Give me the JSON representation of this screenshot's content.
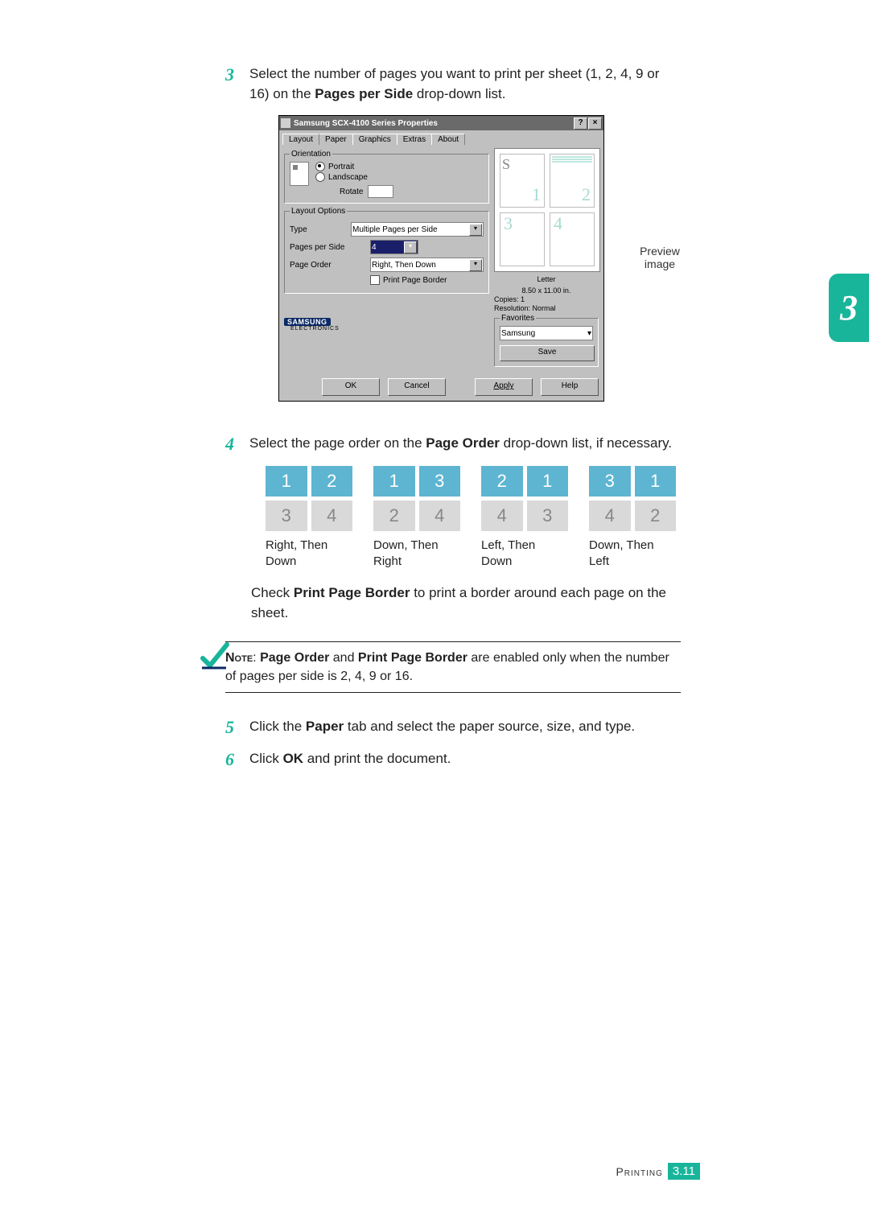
{
  "sideTab": "3",
  "steps": {
    "s3": {
      "num": "3",
      "text_a": "Select the number of pages you want to print per sheet (1, 2, 4, 9 or 16) on the ",
      "bold": "Pages per Side",
      "text_b": " drop-down list."
    },
    "s4": {
      "num": "4",
      "text_a": "Select the page order on the ",
      "bold": "Page Order",
      "text_b": " drop-down list, if necessary."
    },
    "s5": {
      "num": "5",
      "text_a": "Click the ",
      "bold": "Paper",
      "text_b": " tab and select the paper source, size, and type."
    },
    "s6": {
      "num": "6",
      "text_a": "Click ",
      "bold": "OK",
      "text_b": " and print the document."
    }
  },
  "dialog": {
    "title": "Samsung SCX-4100 Series Properties",
    "help_btn": "?",
    "close_btn": "×",
    "tabs": [
      "Layout",
      "Paper",
      "Graphics",
      "Extras",
      "About"
    ],
    "orientation": {
      "legend": "Orientation",
      "portrait": "Portrait",
      "landscape": "Landscape",
      "rotate": "Rotate"
    },
    "callout": "Preview image",
    "layout": {
      "legend": "Layout Options",
      "type_label": "Type",
      "type_value": "Multiple Pages per Side",
      "pps_label": "Pages per Side",
      "pps_value": "4",
      "order_label": "Page Order",
      "order_value": "Right, Then Down",
      "border_label": "Print Page Border"
    },
    "preview": {
      "s_char": "S",
      "nums": [
        "1",
        "2",
        "3",
        "4"
      ],
      "paper_name": "Letter",
      "paper_size": "8.50 x 11.00 in.",
      "copies": "Copies: 1",
      "resolution": "Resolution: Normal"
    },
    "favorites": {
      "legend": "Favorites",
      "value": "Samsung",
      "save": "Save"
    },
    "logo_brand": "SAMSUNG",
    "logo_sub": "ELECTRONICS",
    "buttons": {
      "ok": "OK",
      "cancel": "Cancel",
      "apply": "Apply",
      "help": "Help"
    }
  },
  "orders": [
    {
      "cells": [
        "1",
        "2",
        "3",
        "4"
      ],
      "label": "Right, Then Down"
    },
    {
      "cells": [
        "1",
        "3",
        "2",
        "4"
      ],
      "label": "Down, Then Right"
    },
    {
      "cells": [
        "2",
        "1",
        "4",
        "3"
      ],
      "label": "Left, Then Down"
    },
    {
      "cells": [
        "3",
        "1",
        "4",
        "2"
      ],
      "label": "Down, Then Left"
    }
  ],
  "borderPara": {
    "a": "Check ",
    "bold": "Print Page Border",
    "b": " to print a border around each page on the sheet."
  },
  "note": {
    "sc": "Note",
    "a": ": ",
    "b1": "Page Order",
    "mid": " and ",
    "b2": "Print Page Border",
    "rest": " are enabled only when the number of pages per side is 2, 4, 9 or 16."
  },
  "footer": {
    "section": "Printing",
    "page": "3.11"
  }
}
